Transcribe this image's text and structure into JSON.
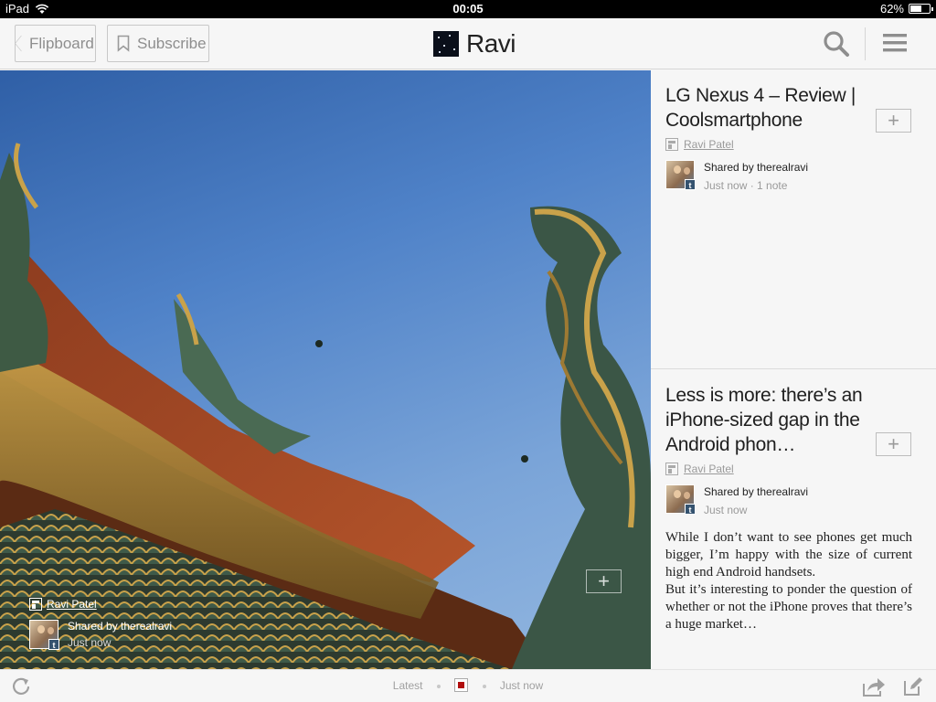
{
  "status_bar": {
    "device": "iPad",
    "time": "00:05",
    "battery": "62%",
    "battery_level": 0.62
  },
  "top_nav": {
    "back_label": "Flipboard",
    "subscribe_label": "Subscribe",
    "title": "Ravi"
  },
  "hero": {
    "source": "Ravi Patel",
    "shared_by": "Shared by therealravi",
    "time": "Just now",
    "add_label": "+"
  },
  "articles": [
    {
      "title": "LG Nexus 4 – Review | Coolsmartphone",
      "source": "Ravi Patel",
      "shared_by": "Shared by therealravi",
      "meta": "Just now · 1 note",
      "add_label": "+"
    },
    {
      "title": "Less is more: there’s an iPhone-sized gap in the Android phon…",
      "source": "Ravi Patel",
      "shared_by": "Shared by therealravi",
      "meta": "Just now",
      "add_label": "+",
      "excerpt_p1": "While I don’t want to see phones get much bigger, I’m happy with the size of current high end Android handsets.",
      "excerpt_p2": "But it’s interesting to ponder the question of whether or not the iPhone proves that there’s a huge market…"
    }
  ],
  "bottom_bar": {
    "left_label": "Latest",
    "right_label": "Just now"
  },
  "icons": {
    "back": "chevron-left-icon",
    "subscribe": "bookmark-icon",
    "search": "search-icon",
    "menu": "menu-icon",
    "refresh": "refresh-icon",
    "share": "share-icon",
    "compose": "compose-icon",
    "source": "flipboard-icon",
    "avatar_badge": "tumblr-icon"
  },
  "colors": {
    "accent_red": "#b10e0e",
    "text_muted": "#9a9a9a"
  }
}
